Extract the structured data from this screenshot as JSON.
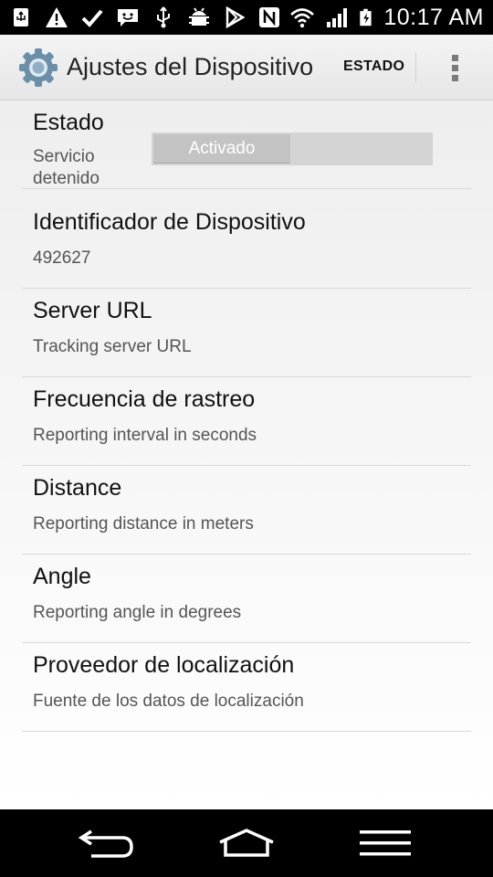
{
  "status_bar": {
    "time": "10:17 AM",
    "icons": [
      "usb-icon",
      "warning-icon",
      "check-icon",
      "message-icon",
      "usb-symbol-icon",
      "android-debug-icon",
      "play-store-icon",
      "nfc-icon",
      "wifi-icon",
      "signal-icon",
      "battery-charging-icon"
    ]
  },
  "action_bar": {
    "title": "Ajustes del Dispositivo",
    "action_label": "ESTADO",
    "app_icon": "gear-icon",
    "overflow_icon": "overflow-menu-icon"
  },
  "preferences": [
    {
      "title": "Estado",
      "summary": "Servicio detenido",
      "switch_label": "Activado"
    },
    {
      "title": "Identificador de Dispositivo",
      "summary": "492627"
    },
    {
      "title": "Server URL",
      "summary": "Tracking server URL"
    },
    {
      "title": "Frecuencia de rastreo",
      "summary": "Reporting interval in seconds"
    },
    {
      "title": "Distance",
      "summary": "Reporting distance in meters"
    },
    {
      "title": "Angle",
      "summary": "Reporting angle in degrees"
    },
    {
      "title": "Proveedor de localización",
      "summary": "Fuente de los datos de localización"
    }
  ],
  "nav_bar": {
    "icons": [
      "back-icon",
      "home-icon",
      "menu-icon"
    ]
  },
  "colors": {
    "accent_gear": "#6a8fa8",
    "switch_track": "#d4d4d4",
    "switch_thumb": "#c3c3c3"
  }
}
